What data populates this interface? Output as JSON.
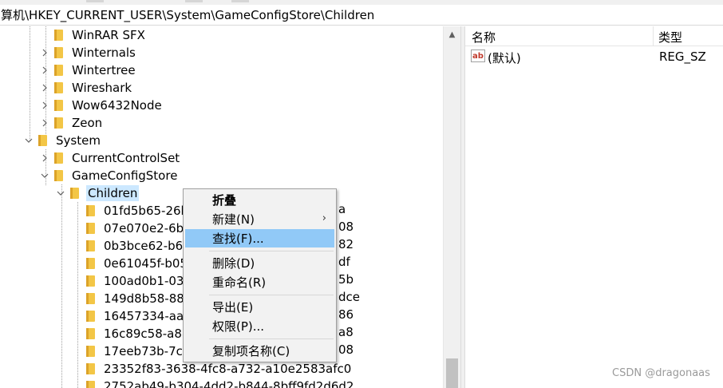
{
  "address": {
    "path": "算机\\HKEY_CURRENT_USER\\System\\GameConfigStore\\Children"
  },
  "tree": {
    "items": [
      {
        "label": "WinRAR SFX",
        "expander": "none"
      },
      {
        "label": "Winternals",
        "expander": "collapsed"
      },
      {
        "label": "Wintertree",
        "expander": "collapsed"
      },
      {
        "label": "Wireshark",
        "expander": "collapsed"
      },
      {
        "label": "Wow6432Node",
        "expander": "collapsed"
      },
      {
        "label": "Zeon",
        "expander": "collapsed"
      },
      {
        "label": "System",
        "expander": "expanded"
      },
      {
        "label": "CurrentControlSet",
        "expander": "collapsed"
      },
      {
        "label": "GameConfigStore",
        "expander": "expanded"
      },
      {
        "label": "Children",
        "expander": "expanded",
        "selected": true
      },
      {
        "label": "01fd5b65-26bf-",
        "suffix": "a"
      },
      {
        "label": "07e070e2-6b",
        "suffix": "08"
      },
      {
        "label": "0b3bce62-b6",
        "suffix": "82"
      },
      {
        "label": "0e61045f-b05",
        "suffix": "df"
      },
      {
        "label": "100ad0b1-03",
        "suffix": "5b"
      },
      {
        "label": "149d8b58-88",
        "suffix": "dce"
      },
      {
        "label": "16457334-aa",
        "suffix": "86"
      },
      {
        "label": "16c89c58-a88",
        "suffix": "a8"
      },
      {
        "label": "17eeb73b-7c",
        "suffix": "08"
      },
      {
        "label": "23352f83-3638-4fc8-a732-a10e2583afc0",
        "suffix": ""
      },
      {
        "label": "2752ab49-b304-4dd2-b844-8bff9fd2d6d2",
        "suffix": ""
      }
    ]
  },
  "values_pane": {
    "header": {
      "name": "名称",
      "type": "类型"
    },
    "rows": [
      {
        "icon": "ab",
        "name": "(默认)",
        "type": "REG_SZ"
      }
    ]
  },
  "context_menu": {
    "items": [
      {
        "label": "折叠",
        "bold": true
      },
      {
        "label": "新建(N)",
        "has_submenu": true
      },
      {
        "label": "查找(F)...",
        "highlighted": true
      },
      {
        "separator": true
      },
      {
        "label": "删除(D)"
      },
      {
        "label": "重命名(R)"
      },
      {
        "separator": true
      },
      {
        "label": "导出(E)"
      },
      {
        "label": "权限(P)..."
      },
      {
        "separator": true
      },
      {
        "label": "复制项名称(C)"
      }
    ],
    "submenu_glyph": "›"
  },
  "watermark": "CSDN @dragonaas",
  "colors": {
    "selection": "#cce8ff",
    "menu_highlight": "#91c9f7",
    "folder": "#f3c646"
  }
}
